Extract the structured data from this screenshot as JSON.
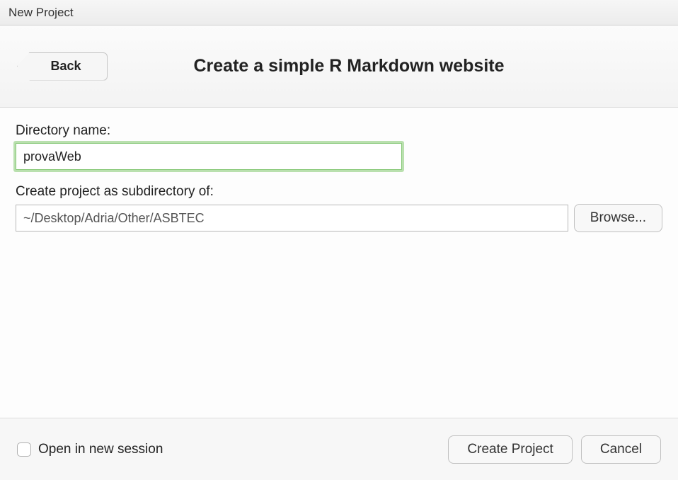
{
  "window": {
    "title": "New Project"
  },
  "header": {
    "back_label": "Back",
    "title": "Create a simple R Markdown website"
  },
  "form": {
    "directory_name_label": "Directory name:",
    "directory_name_value": "provaWeb",
    "subdirectory_label": "Create project as subdirectory of:",
    "subdirectory_value": "~/Desktop/Adria/Other/ASBTEC",
    "browse_label": "Browse..."
  },
  "footer": {
    "open_new_session_label": "Open in new session",
    "open_new_session_checked": false,
    "create_project_label": "Create Project",
    "cancel_label": "Cancel"
  }
}
